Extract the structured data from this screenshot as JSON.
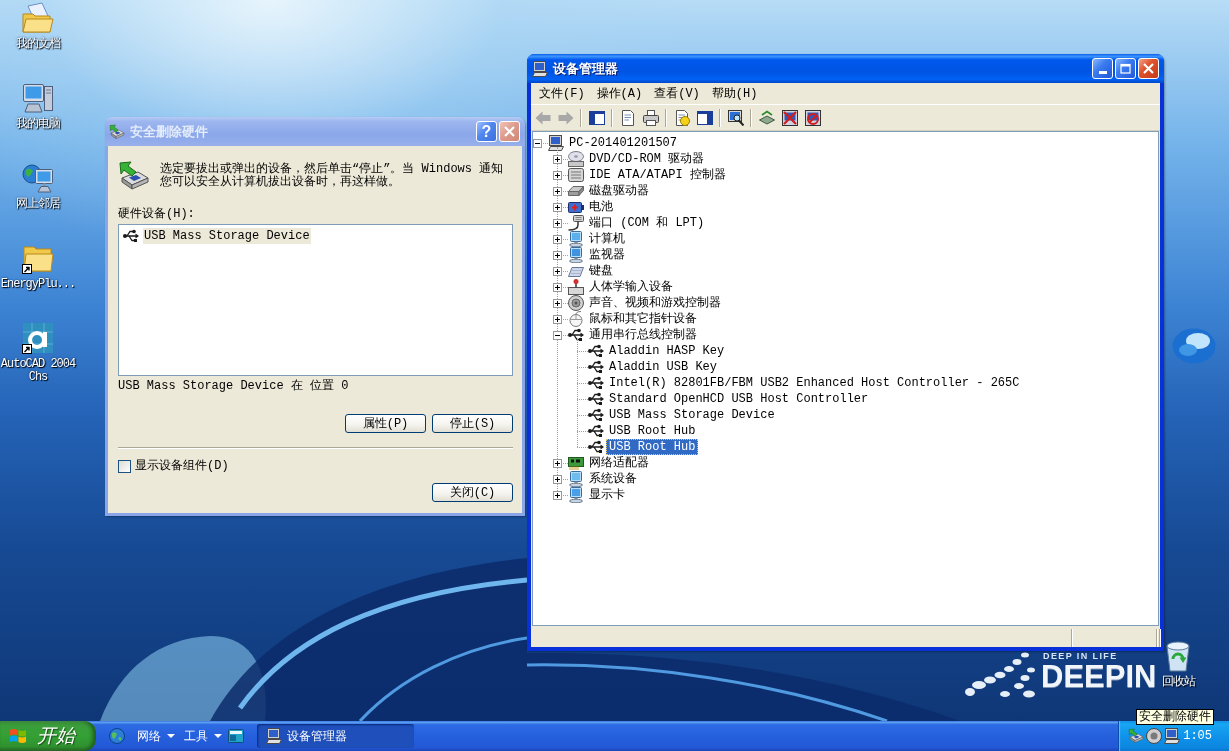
{
  "desktop": {
    "icons": [
      {
        "kind": "documents",
        "label": "我的文档",
        "shortcut": false
      },
      {
        "kind": "computer",
        "label": "我的电脑",
        "shortcut": false
      },
      {
        "kind": "network",
        "label": "网上邻居",
        "shortcut": false
      },
      {
        "kind": "folder",
        "label": "EnergyPlu...",
        "shortcut": true
      },
      {
        "kind": "autocad",
        "label": "AutoCAD 2004 Chs",
        "shortcut": true
      }
    ],
    "recycle_bin": {
      "label": "回收站"
    },
    "wallpaper": {
      "tagline": "DEEP IN LIFE",
      "logo": "DEEPIN"
    }
  },
  "dialog": {
    "title": "安全删除硬件",
    "active": false,
    "title_buttons": [
      {
        "kind": "help",
        "label": "?"
      },
      {
        "kind": "close"
      }
    ],
    "message": "选定要拔出或弹出的设备，然后单击“停止”。当 Windows 通知您可以安全从计算机拔出设备时，再这样做。",
    "list_label": "硬件设备(H):",
    "devices": [
      {
        "label": "USB Mass Storage Device",
        "selected": true
      }
    ],
    "status": "USB Mass Storage Device 在 位置 0",
    "buttons": [
      {
        "label": "属性(P)"
      },
      {
        "label": "停止(S)"
      }
    ],
    "checkbox": {
      "label": "显示设备组件(D)",
      "checked": false
    },
    "close_button": {
      "label": "关闭(C)"
    }
  },
  "device_manager": {
    "title": "设备管理器",
    "active": true,
    "title_buttons": [
      {
        "kind": "minimize"
      },
      {
        "kind": "maximize"
      },
      {
        "kind": "close"
      }
    ],
    "menu": [
      {
        "label": "文件(F)"
      },
      {
        "label": "操作(A)"
      },
      {
        "label": "查看(V)"
      },
      {
        "label": "帮助(H)"
      }
    ],
    "toolbar": [
      {
        "buttons": [
          {
            "kind": "back",
            "disabled": true
          },
          {
            "kind": "forward",
            "disabled": true
          }
        ]
      },
      {
        "buttons": [
          {
            "kind": "tree-pane",
            "disabled": false
          }
        ]
      },
      {
        "buttons": [
          {
            "kind": "properties",
            "disabled": false
          },
          {
            "kind": "print",
            "disabled": false
          }
        ]
      },
      {
        "buttons": [
          {
            "kind": "help",
            "disabled": false
          },
          {
            "kind": "action-pane",
            "disabled": false
          }
        ]
      },
      {
        "buttons": [
          {
            "kind": "scan",
            "disabled": false
          }
        ]
      },
      {
        "buttons": [
          {
            "kind": "update",
            "disabled": false
          },
          {
            "kind": "uninstall",
            "disabled": false
          },
          {
            "kind": "disable",
            "disabled": false
          }
        ]
      }
    ],
    "tree": [
      {
        "label": "PC-201401201507",
        "kind": "pc",
        "expanded": true,
        "selected": false,
        "children": [
          {
            "label": "DVD/CD-ROM 驱动器",
            "kind": "dvd",
            "expanded": false,
            "selected": false
          },
          {
            "label": "IDE ATA/ATAPI 控制器",
            "kind": "ide",
            "expanded": false,
            "selected": false
          },
          {
            "label": "磁盘驱动器",
            "kind": "disk",
            "expanded": false,
            "selected": false
          },
          {
            "label": "电池",
            "kind": "battery",
            "expanded": false,
            "selected": false
          },
          {
            "label": "端口 (COM 和 LPT)",
            "kind": "port",
            "expanded": false,
            "selected": false
          },
          {
            "label": "计算机",
            "kind": "computer",
            "expanded": false,
            "selected": false
          },
          {
            "label": "监视器",
            "kind": "monitor",
            "expanded": false,
            "selected": false
          },
          {
            "label": "键盘",
            "kind": "keyboard",
            "expanded": false,
            "selected": false
          },
          {
            "label": "人体学输入设备",
            "kind": "hid",
            "expanded": false,
            "selected": false
          },
          {
            "label": "声音、视频和游戏控制器",
            "kind": "sound",
            "expanded": false,
            "selected": false
          },
          {
            "label": "鼠标和其它指针设备",
            "kind": "mouse",
            "expanded": false,
            "selected": false
          },
          {
            "label": "通用串行总线控制器",
            "kind": "usb",
            "expanded": true,
            "selected": false,
            "children": [
              {
                "label": "Aladdin HASP Key",
                "kind": "usb",
                "selected": false
              },
              {
                "label": "Aladdin USB Key",
                "kind": "usb",
                "selected": false
              },
              {
                "label": "Intel(R) 82801FB/FBM USB2 Enhanced Host Controller - 265C",
                "kind": "usb",
                "selected": false
              },
              {
                "label": "Standard OpenHCD USB Host Controller",
                "kind": "usb",
                "selected": false
              },
              {
                "label": "USB Mass Storage Device",
                "kind": "usb",
                "selected": false
              },
              {
                "label": "USB Root Hub",
                "kind": "usb",
                "selected": false
              },
              {
                "label": "USB Root Hub",
                "kind": "usb",
                "selected": true
              }
            ]
          },
          {
            "label": "网络适配器",
            "kind": "network",
            "expanded": false,
            "selected": false
          },
          {
            "label": "系统设备",
            "kind": "system",
            "expanded": false,
            "selected": false
          },
          {
            "label": "显示卡",
            "kind": "display",
            "expanded": false,
            "selected": false
          }
        ]
      }
    ]
  },
  "taskbar": {
    "start": {
      "label": "开始"
    },
    "toolbars": [
      {
        "label": "网络"
      },
      {
        "label": "工具"
      }
    ],
    "tasks": [
      {
        "label": "设备管理器",
        "selected": true
      }
    ],
    "clock": "1:05",
    "tooltip": "安全删除硬件"
  }
}
